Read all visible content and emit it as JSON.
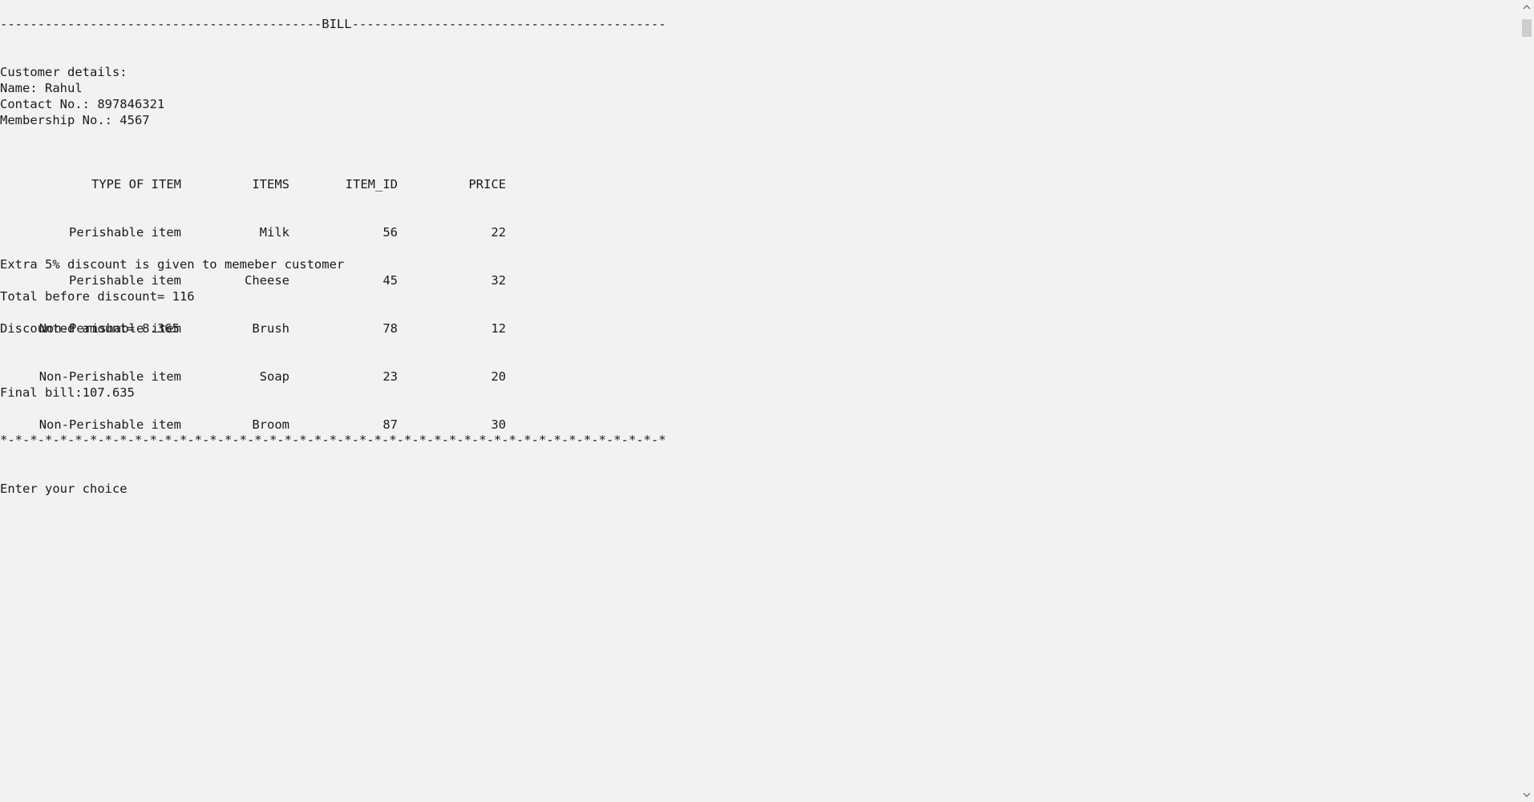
{
  "bill": {
    "top_rule": "-------------------------------------------BILL------------------------------------------",
    "customer_heading": "Customer details:",
    "name_line": "Name: Rahul",
    "contact_line": "Contact No.: 897846321",
    "membership_line": "Membership No.: 4567",
    "table": {
      "headers": [
        "TYPE OF ITEM",
        "ITEMS",
        "ITEM_ID",
        "PRICE"
      ],
      "rows": [
        [
          "Perishable item",
          "Milk",
          "56",
          "22"
        ],
        [
          "Perishable item",
          "Cheese",
          "45",
          "32"
        ],
        [
          "Non-Perishable item",
          "Brush",
          "78",
          "12"
        ],
        [
          "Non-Perishable item",
          "Soap",
          "23",
          "20"
        ],
        [
          "Non-Perishable item",
          "Broom",
          "87",
          "30"
        ]
      ]
    },
    "discount_note": "Extra 5% discount is given to memeber customer",
    "total_line": "Total before discount= 116",
    "discounted_line": "Discounted amount= 8.365",
    "final_line": "Final bill:107.635",
    "bottom_rule": "*-*-*-*-*-*-*-*-*-*-*-*-*-*-*-*-*-*-*-*-*-*-*-*-*-*-*-*-*-*-*-*-*-*-*-*-*-*-*-*-*-*-*-*-*",
    "prompt": "Enter your choice"
  },
  "scrollbar": {
    "up_icon": "chevron-up-icon",
    "down_icon": "chevron-down-icon"
  }
}
